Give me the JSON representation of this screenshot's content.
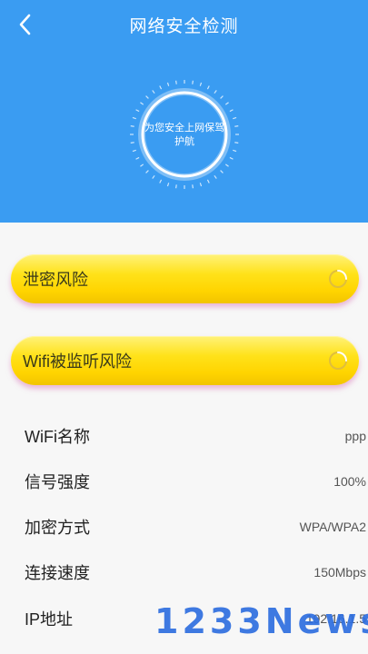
{
  "header": {
    "title": "网络安全检测",
    "back_icon": "chevron-left-icon",
    "background_color": "#3a9cf2",
    "scan_text": "为您安全上网保驾护航"
  },
  "risks": [
    {
      "label": "泄密风险",
      "status_icon": "loading-spinner-icon"
    },
    {
      "label": "Wifi被监听风险",
      "status_icon": "loading-spinner-icon"
    }
  ],
  "info": {
    "wifi_name": {
      "label": "WiFi名称",
      "value": "ppp"
    },
    "signal": {
      "label": "信号强度",
      "value": "100%"
    },
    "encryption": {
      "label": "加密方式",
      "value": "WPA/WPA2"
    },
    "speed": {
      "label": "连接速度",
      "value": "150Mbps"
    },
    "ip": {
      "label": "IP地址",
      "value": "192.16.1.5"
    }
  },
  "watermark": "1233News",
  "colors": {
    "pill_yellow": "#ffd400",
    "accent_blue": "#3a9cf2"
  }
}
